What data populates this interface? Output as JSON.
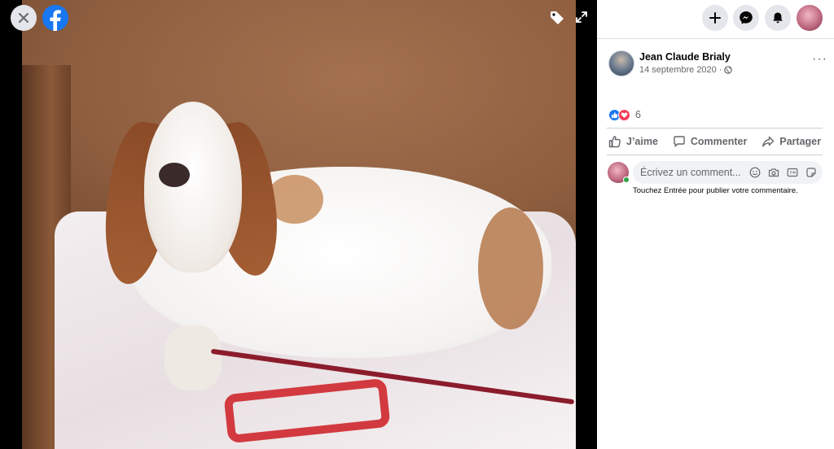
{
  "viewer": {
    "close_label": "✕",
    "photo_alt": "Basset hound lying on a blanket"
  },
  "topbar": {
    "create_label": "+",
    "icons": [
      "plus-icon",
      "messenger-icon",
      "bell-icon",
      "profile-avatar"
    ]
  },
  "post": {
    "author": "Jean Claude Brialy",
    "date": "14 septembre 2020",
    "separator": "·",
    "more": "···",
    "reaction_count": "6"
  },
  "actions": {
    "like": "J’aime",
    "comment": "Commenter",
    "share": "Partager"
  },
  "comment": {
    "placeholder": "Écrivez un commentaire...",
    "placeholder_visible": "Écrivez un comment...",
    "hint": "Touchez Entrée pour publier votre commentaire."
  },
  "colors": {
    "brand": "#1877f2",
    "love": "#f33e58",
    "secondary_text": "#65676b",
    "online": "#31a24c"
  }
}
